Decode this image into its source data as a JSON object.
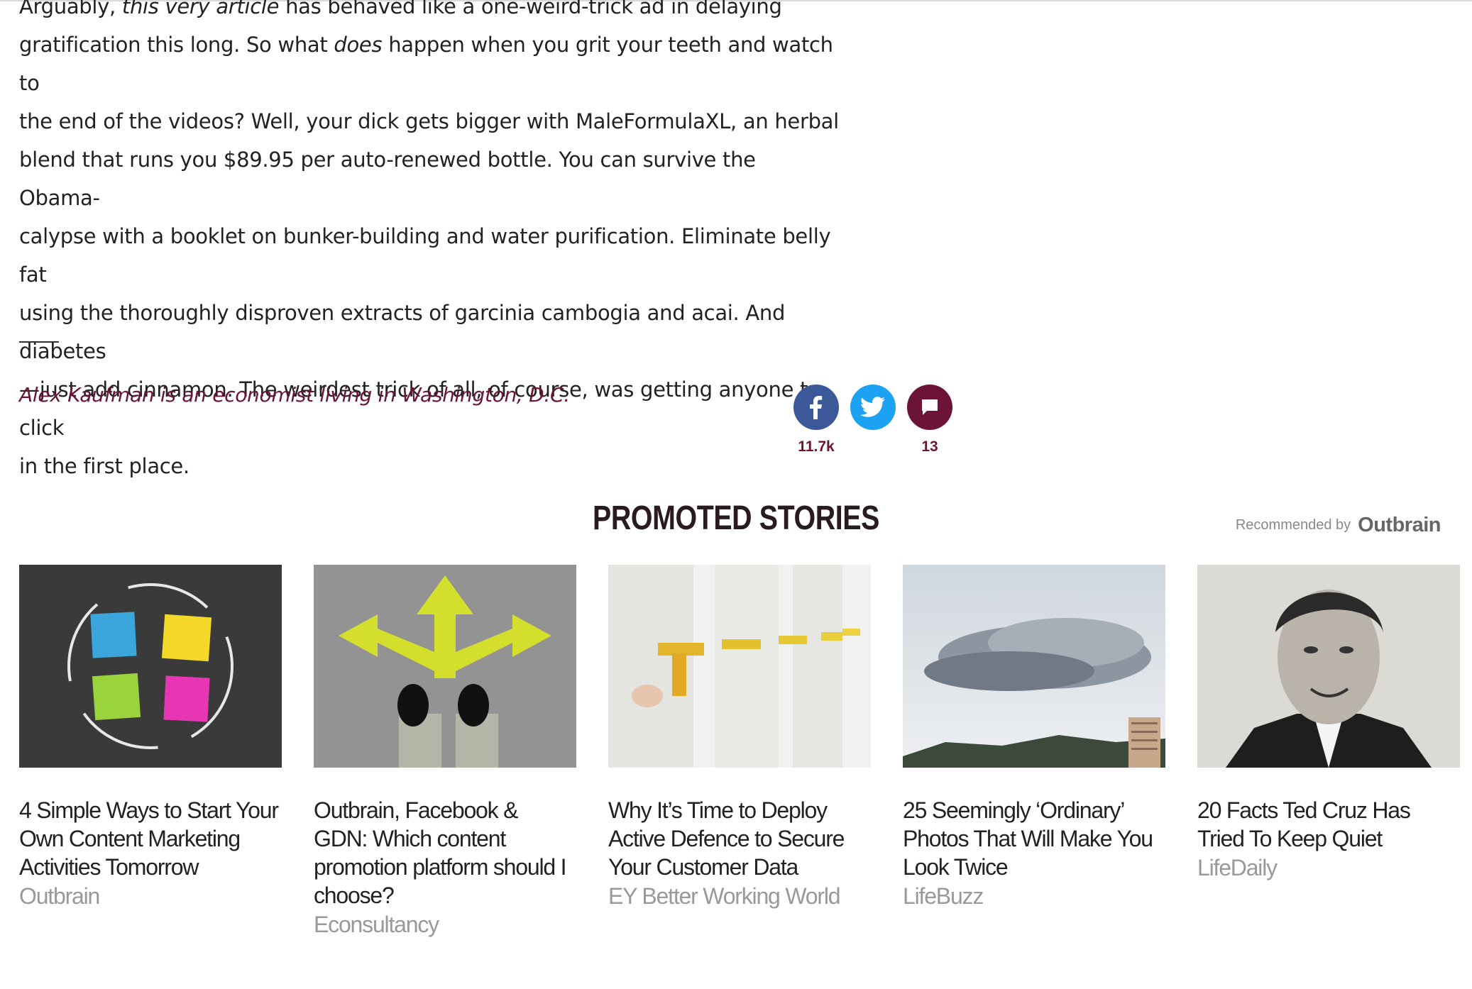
{
  "article": {
    "lines": [
      [
        {
          "t": "Arguably, "
        },
        {
          "t": "this very article",
          "i": true
        },
        {
          "t": " has behaved like a one-weird-trick ad in delaying"
        }
      ],
      [
        {
          "t": "gratification this long. So what "
        },
        {
          "t": "does",
          "i": true
        },
        {
          "t": " happen when you grit your teeth and watch to"
        }
      ],
      [
        {
          "t": "the end of the videos? Well, your dick gets bigger with MaleFormulaXL, an herbal"
        }
      ],
      [
        {
          "t": "blend that runs you $89.95 per auto-renewed bottle. You can survive the Obama-"
        }
      ],
      [
        {
          "t": "calypse with a booklet on bunker-building and water purification. Eliminate belly fat"
        }
      ],
      [
        {
          "t": "using the thoroughly disproven extracts of garcinia cambogia and acai. And diabetes"
        }
      ],
      [
        {
          "t": "—just add cinnamon. The weirdest trick of all, of course, was getting anyone to click"
        }
      ],
      [
        {
          "t": "in the first place."
        }
      ]
    ],
    "bio": "Alex Kaufman is an economist living in Washington, D.C."
  },
  "share": {
    "facebook_icon": "facebook-icon",
    "twitter_icon": "twitter-icon",
    "comment_icon": "comment-icon",
    "facebook_count": "11.7k",
    "comment_count": "13",
    "colors": {
      "facebook": "#3b5998",
      "twitter": "#1da1f2",
      "comment": "#6b1437"
    }
  },
  "promoted": {
    "title": "PROMOTED STORIES",
    "recommended_label": "Recommended by",
    "recommended_brand": "Outbrain",
    "stories": [
      {
        "title": "4 Simple Ways to Start Your Own Content Marketing Activities Tomorrow",
        "source": "Outbrain"
      },
      {
        "title": "Outbrain, Facebook & GDN: Which content promotion platform should I choose?",
        "source": "Econsultancy"
      },
      {
        "title": "Why It’s Time to Deploy Active Defence to Secure Your Customer Data",
        "source": "EY Better Working World"
      },
      {
        "title": "25 Seemingly ‘Ordinary’ Photos That Will Make You Look Twice",
        "source": "LifeBuzz"
      },
      {
        "title": "20 Facts Ted Cruz Has Tried To Keep Quiet",
        "source": "LifeDaily"
      }
    ]
  }
}
